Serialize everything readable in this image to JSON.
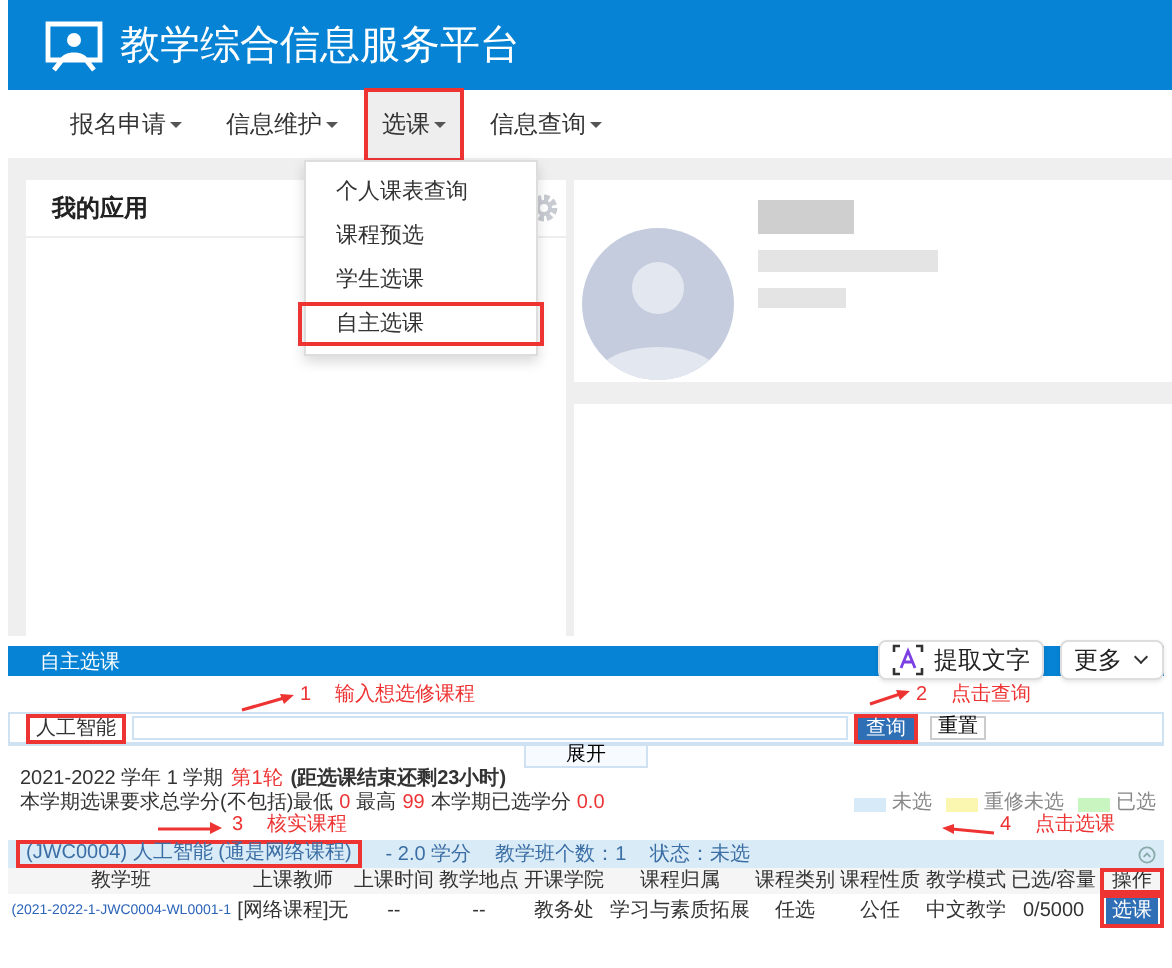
{
  "header": {
    "title": "教学综合信息服务平台"
  },
  "nav": [
    {
      "label": "报名申请",
      "selected": false,
      "highlighted": false
    },
    {
      "label": "信息维护",
      "selected": false,
      "highlighted": false
    },
    {
      "label": "选课",
      "selected": true,
      "highlighted": true
    },
    {
      "label": "信息查询",
      "selected": false,
      "highlighted": false
    }
  ],
  "dropdown": [
    {
      "label": "个人课表查询",
      "highlighted": false
    },
    {
      "label": "课程预选",
      "highlighted": false
    },
    {
      "label": "学生选课",
      "highlighted": false
    },
    {
      "label": "自主选课",
      "highlighted": true
    }
  ],
  "my_apps": {
    "title": "我的应用"
  },
  "toolbar": [
    {
      "label": "提取文字",
      "kind": "ocr"
    },
    {
      "label": "更多",
      "kind": "menu"
    }
  ],
  "embedded": {
    "title": "自主选课",
    "annotations": [
      {
        "number": "1",
        "text": "输入想选修课程"
      },
      {
        "number": "2",
        "text": "点击查询"
      },
      {
        "number": "3",
        "text": "核实课程"
      },
      {
        "number": "4",
        "text": "点击选课"
      }
    ],
    "search": {
      "value": "人工智能",
      "highlighted": true
    },
    "query_button": {
      "label": "查询",
      "highlighted": true
    },
    "reset_button": "重置",
    "expand": "展开",
    "term": {
      "year": "2021-2022 学年 1 学期",
      "round": "第1轮",
      "remaining": "(距选课结束还剩23小时)",
      "requirement": "本学期选课要求总学分(不包括)最低",
      "min": "0",
      "max_label": "最高",
      "max": "99",
      "chosen_label": "本学期已选学分",
      "chosen": "0.0"
    },
    "legend": [
      {
        "label": "未选",
        "color": "#d6eaf8"
      },
      {
        "label": "重修未选",
        "color": "#fbf6b0"
      },
      {
        "label": "已选",
        "color": "#c8f5c0"
      }
    ],
    "course": {
      "title": "(JWC0004) 人工智能 (通是网络课程)",
      "highlighted": true,
      "credits": "- 2.0 学分",
      "classes": "教学班个数：1",
      "status": "状态：未选"
    },
    "columns": [
      "教学班",
      "上课教师",
      "上课时间",
      "教学地点",
      "开课学院",
      "课程归属",
      "课程类别",
      "课程性质",
      "教学模式",
      "已选/容量",
      "操作"
    ],
    "rows": [
      {
        "cells": [
          "(2021-2022-1-JWC0004-WL0001-1",
          "[网络课程]无",
          "--",
          "--",
          "教务处",
          "学习与素质拓展",
          "任选",
          "公任",
          "中文教学",
          "0/5000"
        ],
        "action": "选课",
        "action_highlighted": true
      }
    ]
  }
}
